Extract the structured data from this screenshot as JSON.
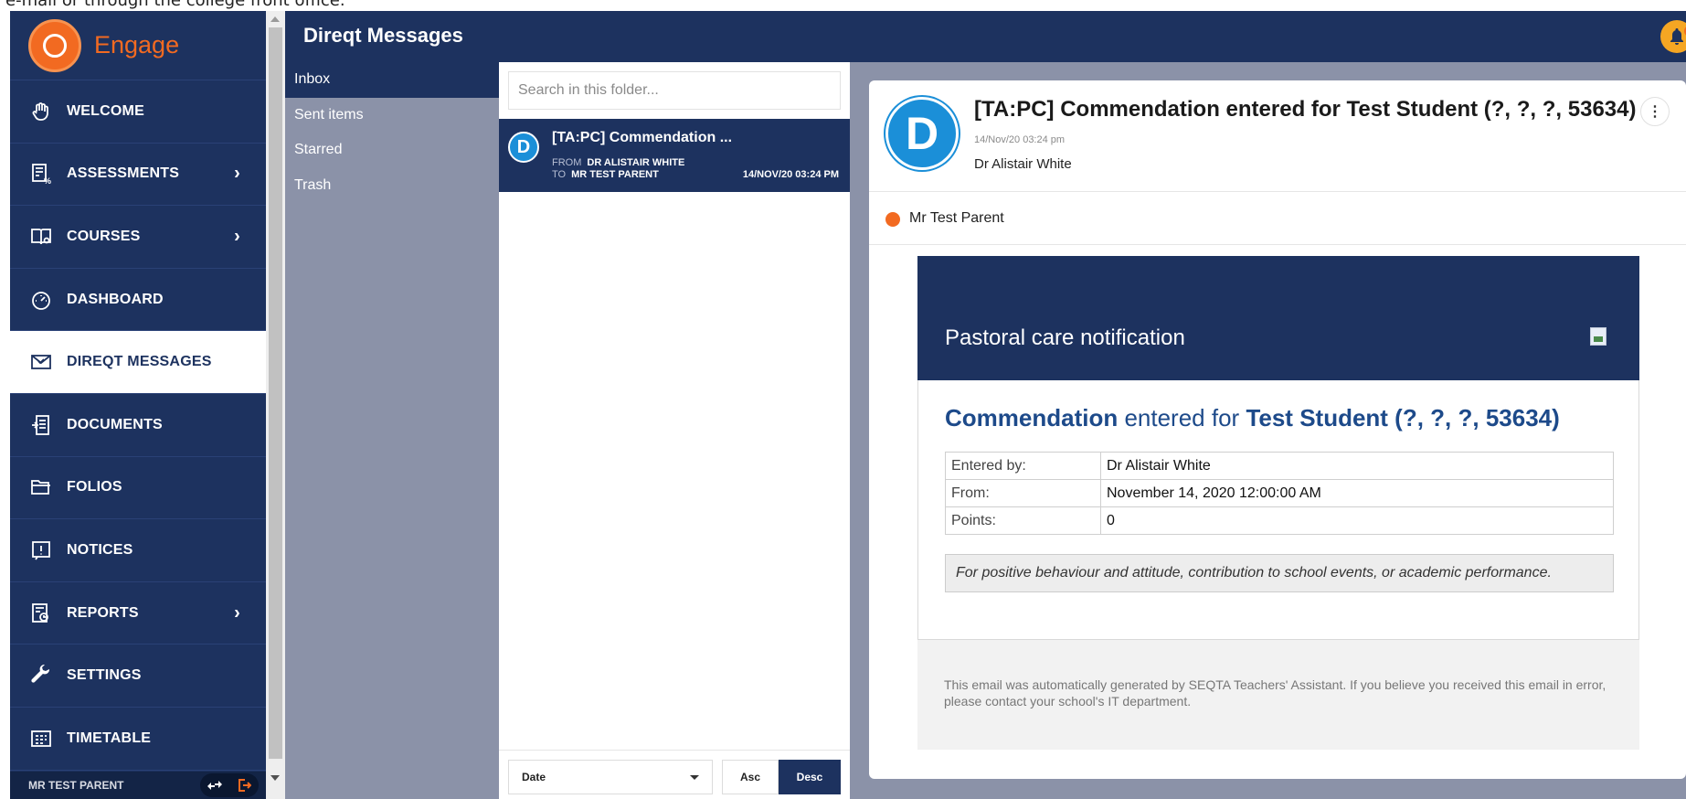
{
  "caption": "e-mail or through the college front office.",
  "app": {
    "logo_text": "Engage",
    "colors": {
      "navy": "#1d325f",
      "orange": "#f26a21",
      "blue": "#1b8fd8"
    }
  },
  "sidebar": {
    "items": [
      {
        "label": "WELCOME",
        "icon": "hand-wave-icon",
        "chevron": false,
        "active": false
      },
      {
        "label": "ASSESSMENTS",
        "icon": "assessment-icon",
        "chevron": true,
        "active": false
      },
      {
        "label": "COURSES",
        "icon": "book-icon",
        "chevron": true,
        "active": false
      },
      {
        "label": "DASHBOARD",
        "icon": "gauge-icon",
        "chevron": false,
        "active": false
      },
      {
        "label": "DIREQT MESSAGES",
        "icon": "envelope-icon",
        "chevron": false,
        "active": true
      },
      {
        "label": "DOCUMENTS",
        "icon": "document-icon",
        "chevron": false,
        "active": false
      },
      {
        "label": "FOLIOS",
        "icon": "folder-icon",
        "chevron": false,
        "active": false
      },
      {
        "label": "NOTICES",
        "icon": "notice-icon",
        "chevron": false,
        "active": false
      },
      {
        "label": "REPORTS",
        "icon": "report-icon",
        "chevron": true,
        "active": false
      },
      {
        "label": "SETTINGS",
        "icon": "wrench-icon",
        "chevron": false,
        "active": false
      },
      {
        "label": "TIMETABLE",
        "icon": "timetable-icon",
        "chevron": false,
        "active": false
      }
    ],
    "footer": {
      "user": "MR TEST PARENT"
    }
  },
  "header": {
    "title": "Direqt Messages"
  },
  "folders": [
    {
      "label": "Inbox",
      "active": true
    },
    {
      "label": "Sent items",
      "active": false
    },
    {
      "label": "Starred",
      "active": false
    },
    {
      "label": "Trash",
      "active": false
    }
  ],
  "messages": {
    "search_placeholder": "Search in this folder...",
    "item": {
      "avatar": "D",
      "subject": "[TA:PC] Commendation ...",
      "from_key": "FROM",
      "from": "DR ALISTAIR WHITE",
      "to_key": "TO",
      "to": "MR TEST PARENT",
      "date": "14/NOV/20 03:24 PM"
    },
    "sort": {
      "field": "Date",
      "asc": "Asc",
      "desc": "Desc"
    }
  },
  "reader": {
    "avatar": "D",
    "subject": "[TA:PC] Commendation entered for Test Student (?, ?, ?, 53634)",
    "date": "14/Nov/20 03:24 pm",
    "from": "Dr Alistair White",
    "recipient": "Mr Test Parent",
    "kebab": "⋮",
    "email": {
      "banner": "Pastoral care notification",
      "headline_a": "Commendation",
      "headline_b": " entered for ",
      "headline_c": "Test Student (?, ?, ?, 53634)",
      "rows": [
        {
          "k": "Entered by:",
          "v": "Dr Alistair White"
        },
        {
          "k": "From:",
          "v": "November 14, 2020 12:00:00 AM"
        },
        {
          "k": "Points:",
          "v": "0"
        }
      ],
      "note": "For positive behaviour and attitude, contribution to school events, or academic performance.",
      "footer": "This email was automatically generated by SEQTA Teachers' Assistant. If you believe you received this email in error, please contact your school's IT department."
    }
  }
}
